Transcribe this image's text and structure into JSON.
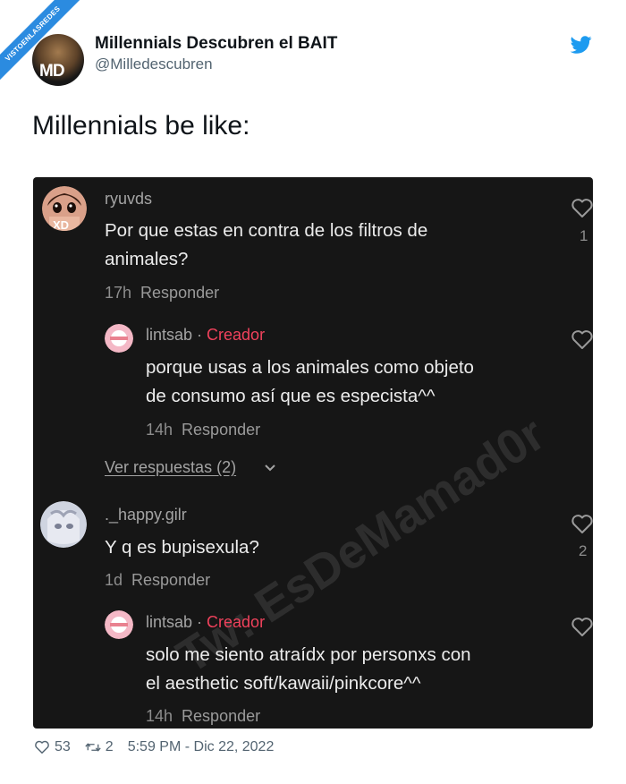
{
  "ribbon": {
    "text": "VISTOENLASREDES",
    "sub": ".com"
  },
  "tweet": {
    "display_name": "Millennials Descubren el BAIT",
    "handle": "@Milledescubren",
    "avatar_text": "MD",
    "text": "Millennials be like:",
    "likes": "53",
    "retweets": "2",
    "timestamp": "5:59 PM - Dic 22, 2022"
  },
  "colors": {
    "twitter_blue": "#1d9bf0",
    "creator_red": "#f0425c",
    "media_bg": "#161616"
  },
  "comments": {
    "c1": {
      "user": "ryuvds",
      "text_line1": "Por que estas en contra de los filtros de",
      "text_line2": "animales?",
      "time": "17h",
      "reply": "Responder",
      "likes": "1"
    },
    "r1": {
      "user": "lintsab",
      "sep": "·",
      "badge": "Creador",
      "text_line1": "porque usas a los animales como objeto",
      "text_line2": "de consumo así que es especista^^",
      "time": "14h",
      "reply": "Responder"
    },
    "view_replies": "Ver respuestas (2)",
    "c2": {
      "user": "._happy.gilr",
      "text_line1": "Y q es bupisexula?",
      "time": "1d",
      "reply": "Responder",
      "likes": "2"
    },
    "r2": {
      "user": "lintsab",
      "sep": "·",
      "badge": "Creador",
      "text_line1": "solo me siento atraídx por personxs con",
      "text_line2": "el aesthetic soft/kawaii/pinkcore^^",
      "time": "14h",
      "reply": "Responder"
    }
  },
  "watermark": "Tw: EsDeMamad0r"
}
